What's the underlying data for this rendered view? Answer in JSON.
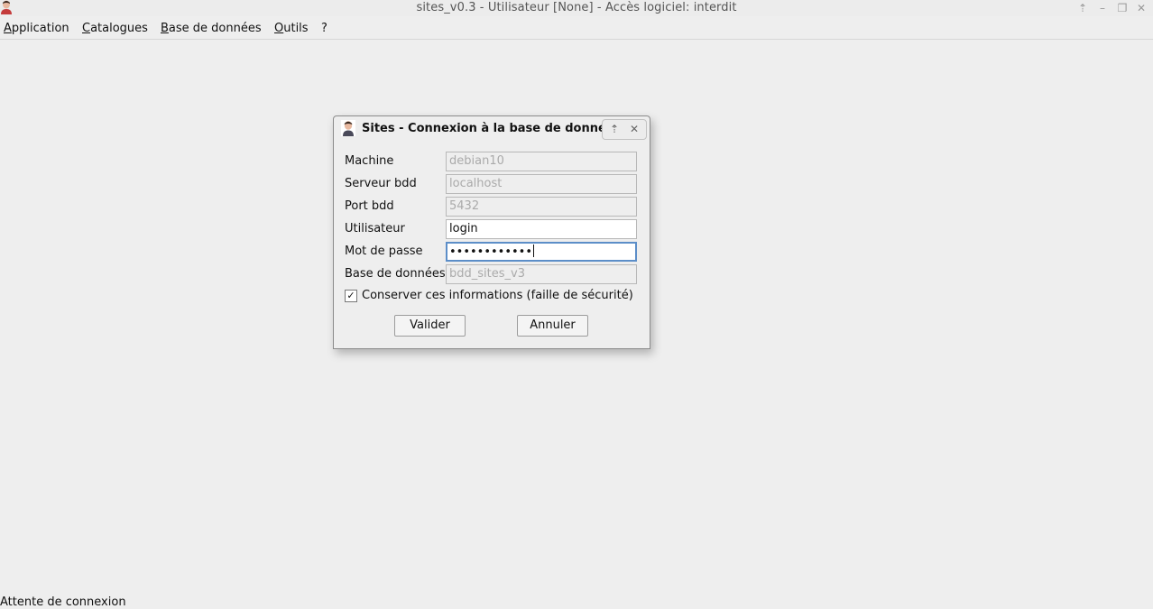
{
  "window": {
    "title": "sites_v0.3 - Utilisateur [None] - Accès logiciel: interdit",
    "controls": {
      "up": "⇡",
      "minimize": "–",
      "maximize": "❐",
      "close": "✕"
    }
  },
  "menubar": {
    "items": [
      {
        "mnemonic": "A",
        "rest": "pplication"
      },
      {
        "mnemonic": "C",
        "rest": "atalogues"
      },
      {
        "mnemonic": "B",
        "rest": "ase de données"
      },
      {
        "mnemonic": "O",
        "rest": "utils"
      },
      {
        "mnemonic": "",
        "rest": "?"
      }
    ]
  },
  "dialog": {
    "title": "Sites - Connexion à la base de données",
    "controls": {
      "up": "⇡",
      "close": "✕"
    },
    "fields": {
      "machine": {
        "label": "Machine",
        "value": "debian10"
      },
      "server": {
        "label": "Serveur bdd",
        "value": "localhost"
      },
      "port": {
        "label": "Port bdd",
        "value": "5432"
      },
      "user": {
        "label": "Utilisateur",
        "value": "login"
      },
      "password": {
        "label": "Mot de passe",
        "value": "••••••••••••"
      },
      "database": {
        "label": "Base de données",
        "value": "bdd_sites_v3"
      }
    },
    "remember": {
      "label": "Conserver ces informations (faille de sécurité)",
      "checked": true,
      "mark": "✓"
    },
    "buttons": {
      "ok": "Valider",
      "cancel": "Annuler"
    }
  },
  "status": {
    "text": "Attente de connexion"
  }
}
